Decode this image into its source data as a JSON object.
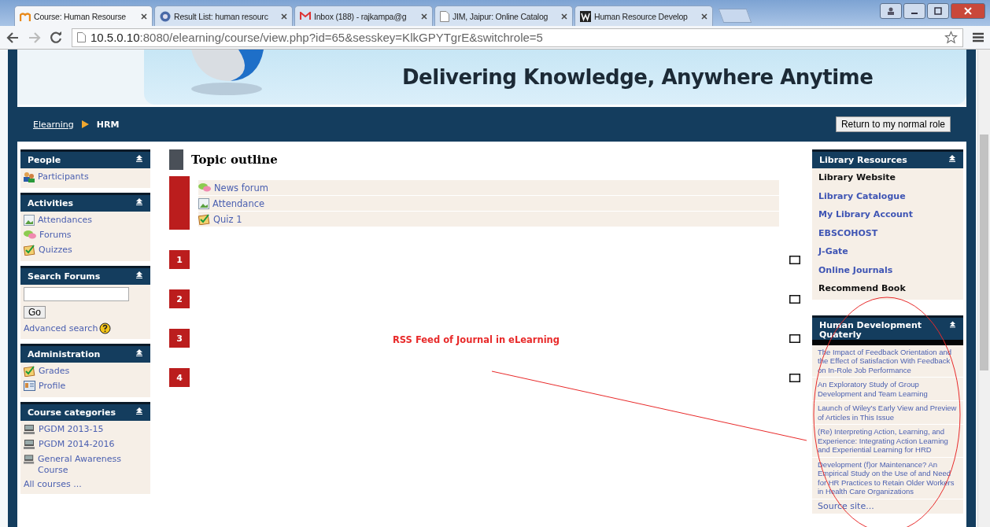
{
  "browser": {
    "tabs": [
      {
        "title": "Course: Human Resourse",
        "kind": "moodle",
        "selected": true
      },
      {
        "title": "Result List: human resourc",
        "kind": "ebsco",
        "selected": false
      },
      {
        "title": "Inbox (188) - rajkampa@g",
        "kind": "mail",
        "selected": false
      },
      {
        "title": "JIM, Jaipur: Online Catalog",
        "kind": "page",
        "selected": false
      },
      {
        "title": "Human Resource Develop",
        "kind": "wiley",
        "selected": false
      }
    ],
    "url_host": "10.5.0.10",
    "url_path": ":8080/elearning/course/view.php?id=65&sesskey=KlkGPYTgrE&switchrole=5"
  },
  "banner": {
    "tagline": "Delivering Knowledge, Anywhere Anytime"
  },
  "navbar": {
    "breadcrumb": [
      {
        "label": "Elearning",
        "link": true
      },
      {
        "label": "HRM",
        "link": false
      }
    ],
    "button": "Return to my normal role"
  },
  "left_blocks": [
    {
      "kind": "list",
      "title": "People",
      "items": [
        {
          "label": "Participants",
          "kind": "people"
        }
      ]
    },
    {
      "kind": "list",
      "title": "Activities",
      "items": [
        {
          "label": "Attendances",
          "kind": "attendance"
        },
        {
          "label": "Forums",
          "kind": "forum"
        },
        {
          "label": "Quizzes",
          "kind": "quiz"
        }
      ]
    },
    {
      "kind": "search",
      "title": "Search Forums",
      "button": "Go",
      "link": "Advanced search"
    },
    {
      "kind": "list",
      "title": "Administration",
      "items": [
        {
          "label": "Grades",
          "kind": "quiz"
        },
        {
          "label": "Profile",
          "kind": "profile"
        }
      ]
    },
    {
      "kind": "list",
      "title": "Course categories",
      "items": [
        {
          "label": "PGDM 2013-15",
          "kind": "computer"
        },
        {
          "label": "PGDM 2014-2016",
          "kind": "computer"
        },
        {
          "label": "General Awareness Course",
          "kind": "computer"
        }
      ],
      "footer": "All courses ..."
    }
  ],
  "topic_outline": {
    "title": "Topic outline",
    "activities": [
      {
        "label": "News forum",
        "kind": "forum"
      },
      {
        "label": "Attendance",
        "kind": "attendance"
      },
      {
        "label": "Quiz 1",
        "kind": "quiz"
      }
    ],
    "sections": [
      "1",
      "2",
      "3",
      "4"
    ]
  },
  "library_block": {
    "title": "Library Resources",
    "items": [
      {
        "label": "Library Website",
        "link": false
      },
      {
        "label": "Library Catalogue",
        "link": true
      },
      {
        "label": "My Library Account",
        "link": true
      },
      {
        "label": "EBSCOHOST",
        "link": true
      },
      {
        "label": "J-Gate",
        "link": true
      },
      {
        "label": "Online Journals",
        "link": true
      },
      {
        "label": "Recommend Book",
        "link": false
      }
    ]
  },
  "rss_block": {
    "title": "Human Development Quaterly",
    "items": [
      "The Impact of Feedback Orientation and the Effect of Satisfaction With Feedback on In-Role Job Performance",
      "An Exploratory Study of Group Development and Team Learning",
      "Launch of Wiley's Early View and Preview of Articles in This Issue",
      "(Re) Interpreting Action, Learning, and Experience: Integrating Action Learning and Experiential Learning for HRD",
      "Development (f)or Maintenance? An Empirical Study on the Use of and Need for HR Practices to Retain Older Workers in Health Care Organizations"
    ],
    "footer": "Source site..."
  },
  "annotation": {
    "label": "RSS Feed of Journal in eLearning"
  }
}
